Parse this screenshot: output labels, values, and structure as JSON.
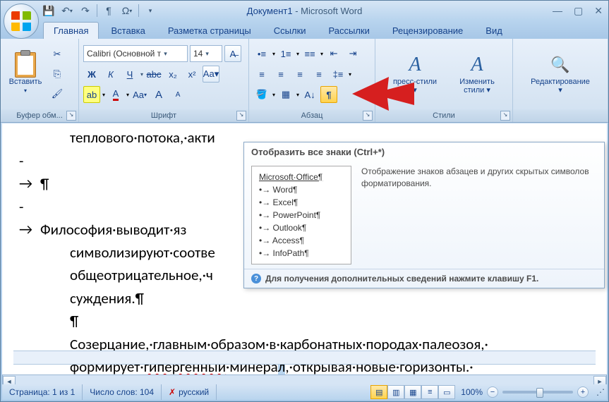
{
  "title": {
    "doc": "Документ1",
    "app": "Microsoft Word"
  },
  "qat": {
    "save": "💾",
    "undo": "↶",
    "redo": "↷",
    "pilcrow": "¶",
    "omega": "Ω"
  },
  "tabs": [
    "Главная",
    "Вставка",
    "Разметка страницы",
    "Ссылки",
    "Рассылки",
    "Рецензирование",
    "Вид"
  ],
  "groups": {
    "clipboard": {
      "label": "Буфер обм...",
      "paste": "Вставить"
    },
    "font": {
      "label": "Шрифт",
      "name": "Calibri (Основной т",
      "size": "14",
      "bold": "Ж",
      "italic": "К",
      "underline": "Ч",
      "strike": "abc",
      "sub": "x₂",
      "sup": "x²",
      "case": "Aa",
      "grow": "A",
      "shrink": "A",
      "highlight": "ab",
      "color": "A"
    },
    "para": {
      "label": "Абзац"
    },
    "styles": {
      "label": "Стили",
      "quick": "пресс-стили",
      "change": "Изменить стили"
    },
    "edit": {
      "label": "Редактирование"
    }
  },
  "tooltip": {
    "title": "Отобразить все знаки (Ctrl+*)",
    "sample_title": "Microsoft·Office¶",
    "sample_items": [
      "Word¶",
      "Excel¶",
      "PowerPoint¶",
      "Outlook¶",
      "Access¶",
      "InfoPath¶"
    ],
    "desc": "Отображение знаков абзацев и других скрытых символов форматирования.",
    "help": "Для получения дополнительных сведений нажмите клавишу F1."
  },
  "document": {
    "l1": "теплового·потока,·акти",
    "l2": "¶",
    "l3a": "Философия·выводит·яз",
    "l3b": "символизируют·соотве",
    "l3c": "общеотрицательное,·ч",
    "l3d": "суждения.¶",
    "l4": "¶",
    "l5": "Созерцание,·главным·образом·в·карбонатных·породах·палеозоя,·",
    "l6a": "формирует·",
    "l6b": "гипергенный",
    "l6c": "·минера",
    "l6d": "л",
    "l6e": ",·открывая·новые·горизонты.·"
  },
  "status": {
    "page": "Страница: 1 из 1",
    "words": "Число слов: 104",
    "lang": "русский",
    "zoom": "100%"
  }
}
